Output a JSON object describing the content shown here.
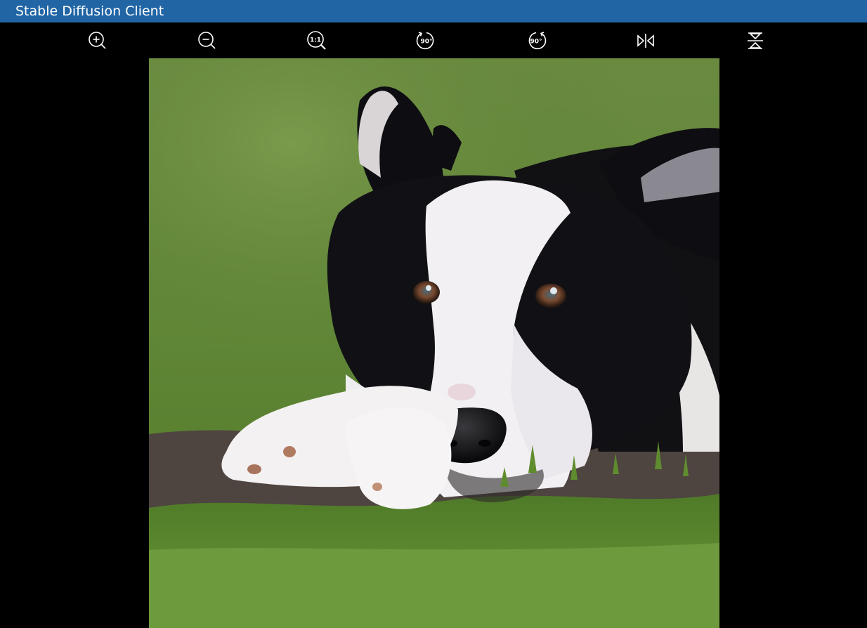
{
  "window": {
    "title": "Stable Diffusion Client"
  },
  "toolbar": {
    "buttons": [
      {
        "name": "zoom-in",
        "icon": "zoom-in-icon"
      },
      {
        "name": "zoom-out",
        "icon": "zoom-out-icon"
      },
      {
        "name": "actual-size",
        "icon": "actual-size-icon",
        "label": "1:1"
      },
      {
        "name": "rotate-left",
        "icon": "rotate-left-icon",
        "label": "90°"
      },
      {
        "name": "rotate-right",
        "icon": "rotate-right-icon",
        "label": "90°"
      },
      {
        "name": "flip-horizontal",
        "icon": "flip-horizontal-icon"
      },
      {
        "name": "flip-vertical",
        "icon": "flip-vertical-icon"
      }
    ]
  },
  "viewer": {
    "image_subject": "border-collie-dog-photo"
  },
  "colors": {
    "titlebar": "#2165a5",
    "background": "#000000",
    "icon": "#ffffff"
  }
}
